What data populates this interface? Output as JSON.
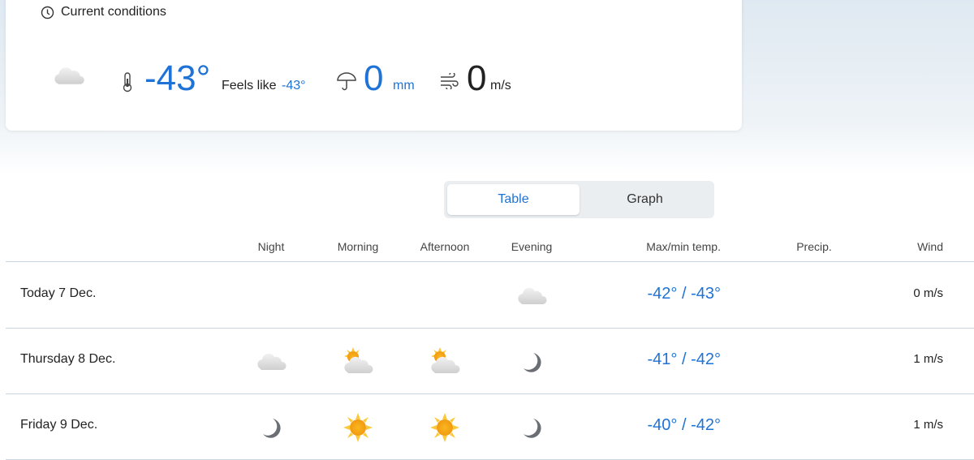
{
  "current": {
    "title": "Current conditions",
    "icon": "moon-cloud",
    "temperature": "-43°",
    "feels_like_label": "Feels like",
    "feels_like_value": "-43°",
    "precip_value": "0",
    "precip_unit": "mm",
    "wind_value": "0",
    "wind_unit": "m/s"
  },
  "view_toggle": {
    "table": "Table",
    "graph": "Graph",
    "selected": "Table"
  },
  "table": {
    "headers": {
      "night": "Night",
      "morning": "Morning",
      "afternoon": "Afternoon",
      "evening": "Evening",
      "maxmin": "Max/min temp.",
      "precip": "Precip.",
      "wind": "Wind"
    },
    "rows": [
      {
        "date": "Today 7 Dec.",
        "icons": [
          null,
          null,
          null,
          "cloud"
        ],
        "max": "-42°",
        "min": "-43°",
        "wind": "0 m/s"
      },
      {
        "date": "Thursday 8 Dec.",
        "icons": [
          "cloud",
          "partly-sunny",
          "partly-sunny",
          "moon"
        ],
        "max": "-41°",
        "min": "-42°",
        "wind": "1 m/s"
      },
      {
        "date": "Friday 9 Dec.",
        "icons": [
          "moon",
          "sun",
          "sun",
          "moon"
        ],
        "max": "-40°",
        "min": "-42°",
        "wind": "1 m/s"
      }
    ]
  }
}
